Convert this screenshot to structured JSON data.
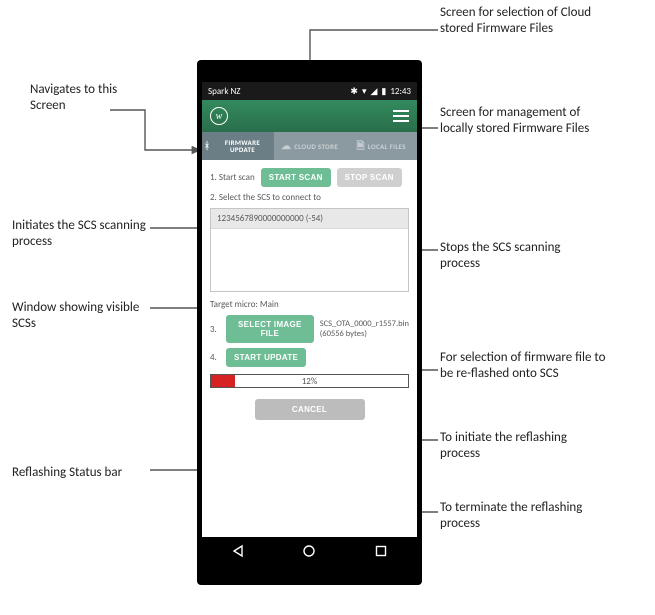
{
  "statusbar": {
    "carrier": "Spark NZ",
    "time": "12:43"
  },
  "tabs": [
    {
      "label": "FIRMWARE UPDATE",
      "icon": "bt"
    },
    {
      "label": "CLOUD STORE",
      "icon": "cloud"
    },
    {
      "label": "LOCAL FILES",
      "icon": "file"
    }
  ],
  "steps": {
    "s1_label": "1. Start scan",
    "start_scan": "START SCAN",
    "stop_scan": "STOP SCAN",
    "s2_label": "2. Select the SCS to connect to",
    "device": "1234567890000000000 (-54)",
    "target_label": "Target micro:",
    "target_value": "Main",
    "s3_num": "3.",
    "select_file": "SELECT IMAGE FILE",
    "file_info": "SCS_OTA_0000_r1557.bin (60556 bytes)",
    "s4_num": "4.",
    "start_update": "START UPDATE",
    "progress_pct": "12%",
    "cancel": "CANCEL"
  },
  "annotations": {
    "nav_screen": "Navigates to this Screen",
    "cloud_tab": "Screen for selection of Cloud stored Firmware Files",
    "local_tab": "Screen for management of locally stored Firmware Files",
    "start_scan_note": "Initiates the SCS scanning process",
    "stop_scan_note": "Stops the SCS scanning process",
    "window_note": "Window showing visible SCSs",
    "file_note": "For selection of firmware file to be re-flashed onto SCS",
    "start_update_note": "To initiate the reflashing process",
    "status_bar_note": "Reflashing Status bar",
    "cancel_note": "To terminate the reflashing process"
  }
}
